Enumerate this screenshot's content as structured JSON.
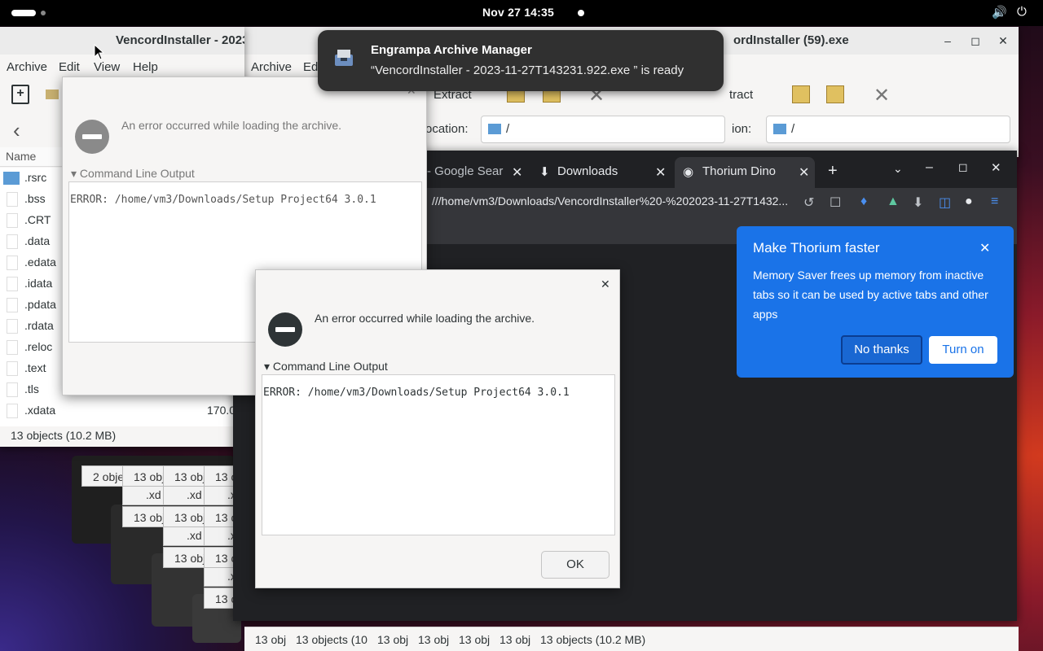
{
  "topbar": {
    "clock": "Nov 27  14:35"
  },
  "window_left": {
    "title": "VencordInstaller - 2023",
    "menu": [
      "Archive",
      "Edit",
      "View",
      "Help"
    ],
    "name_header": "Name",
    "files": [
      ".rsrc",
      ".bss",
      ".CRT",
      ".data",
      ".edata",
      ".idata",
      ".pdata",
      ".rdata",
      ".reloc",
      ".text",
      ".tls",
      ".xdata"
    ],
    "xdata_size": "170.0",
    "status": "13 objects (10.2 MB)"
  },
  "window_right": {
    "title": "ordInstaller (59).exe",
    "menu": [
      "Archive",
      "Ed"
    ],
    "extract_label": "Extract",
    "extract_label_right": "tract",
    "location_label": "ocation:",
    "location_label_right": "ion:",
    "location_value": "/"
  },
  "notification": {
    "app": "Engrampa Archive Manager",
    "message": "“VencordInstaller - 2023-11-27T143231.922.exe ” is ready"
  },
  "dialog_back": {
    "message": "An error occurred while loading the archive.",
    "expander": "Command Line Output",
    "output": "ERROR: /home/vm3/Downloads/Setup Project64 3.0.1"
  },
  "dialog_front": {
    "message": "An error occurred while loading the archive.",
    "expander": "Command Line Output",
    "output": "ERROR: /home/vm3/Downloads/Setup Project64 3.0.1",
    "ok_label": "OK"
  },
  "browser": {
    "tabs": [
      "- Google Sear",
      "Downloads",
      "Thorium Dino"
    ],
    "url": "///home/vm3/Downloads/VencordInstaller%20-%202023-11-27T1432..."
  },
  "promo": {
    "title": "Make Thorium faster",
    "body": "Memory Saver frees up memory from inactive tabs so it can be used by active tabs and other apps",
    "no_thanks": "No thanks",
    "turn_on": "Turn on"
  },
  "ghost_labels": {
    "a": "2 obje",
    "b": "13 obj",
    "c": "13 c",
    "d": ".xd",
    "e": ".x"
  },
  "bottom_status": {
    "short": "13 obj",
    "mid": "13 objects (10",
    "full": "13 objects (10.2 MB)"
  },
  "colors": {
    "promo_blue": "#1a73e8",
    "browser_bg": "#202124"
  }
}
